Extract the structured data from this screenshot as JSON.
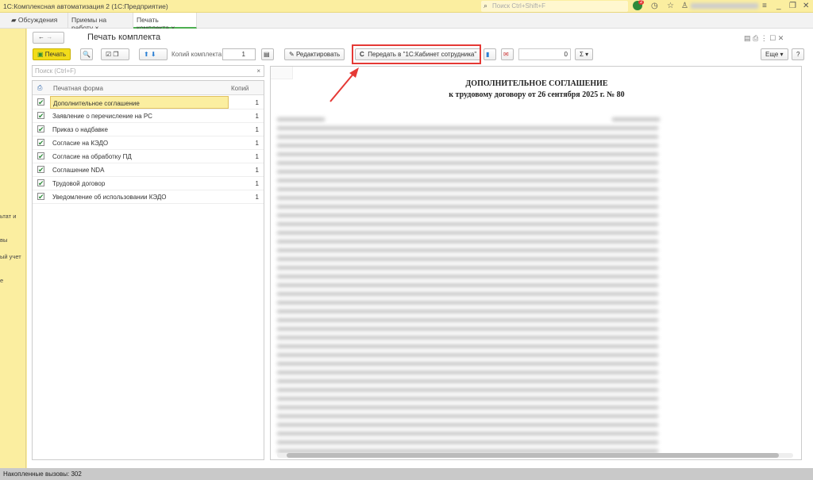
{
  "titlebar": {
    "title": "1С:Комплексная автоматизация 2  (1С:Предприятие)",
    "search_placeholder": "Поиск Ctrl+Shift+F",
    "notif_count": "2"
  },
  "tabs": [
    {
      "label": "Обсуждения"
    },
    {
      "label": "Приемы на работу"
    },
    {
      "label": "Печать комплекта"
    }
  ],
  "sidebar": {
    "items": [
      "ьтат и",
      "вы",
      "ый учет",
      "е"
    ]
  },
  "form": {
    "title": "Печать комплекта",
    "print_label": "Печать",
    "copies_label": "Копий комплекта:",
    "copies_value": "1",
    "edit_label": "Редактировать",
    "send_label": "Передать в \"1С:Кабинет сотрудника\"",
    "sum_value": "0",
    "sum_label": "Σ",
    "more_label": "Еще",
    "help_label": "?"
  },
  "list": {
    "search_placeholder": "Поиск (Ctrl+F)",
    "col_form": "Печатная форма",
    "col_copies": "Копий",
    "rows": [
      {
        "name": "Дополнительное соглашение",
        "copies": "1"
      },
      {
        "name": "Заявление о перечисление на РС",
        "copies": "1"
      },
      {
        "name": "Приказ о надбавке",
        "copies": "1"
      },
      {
        "name": "Согласие на КЭДО",
        "copies": "1"
      },
      {
        "name": "Согласие на обработку ПД",
        "copies": "1"
      },
      {
        "name": "Соглашение NDA",
        "copies": "1"
      },
      {
        "name": "Трудовой договор",
        "copies": "1"
      },
      {
        "name": "Уведомление об использовании КЭДО",
        "copies": "1"
      }
    ]
  },
  "document": {
    "heading": "ДОПОЛНИТЕЛЬНОЕ СОГЛАШЕНИЕ",
    "subheading": "к трудовому договору от 26 сентября 2025 г. № 80"
  },
  "status": {
    "text": "Накопленные вызовы: 302"
  },
  "colors": {
    "accent_yellow": "#fbeea0",
    "highlight_red": "#e53935",
    "check_green": "#2e8b3a"
  }
}
